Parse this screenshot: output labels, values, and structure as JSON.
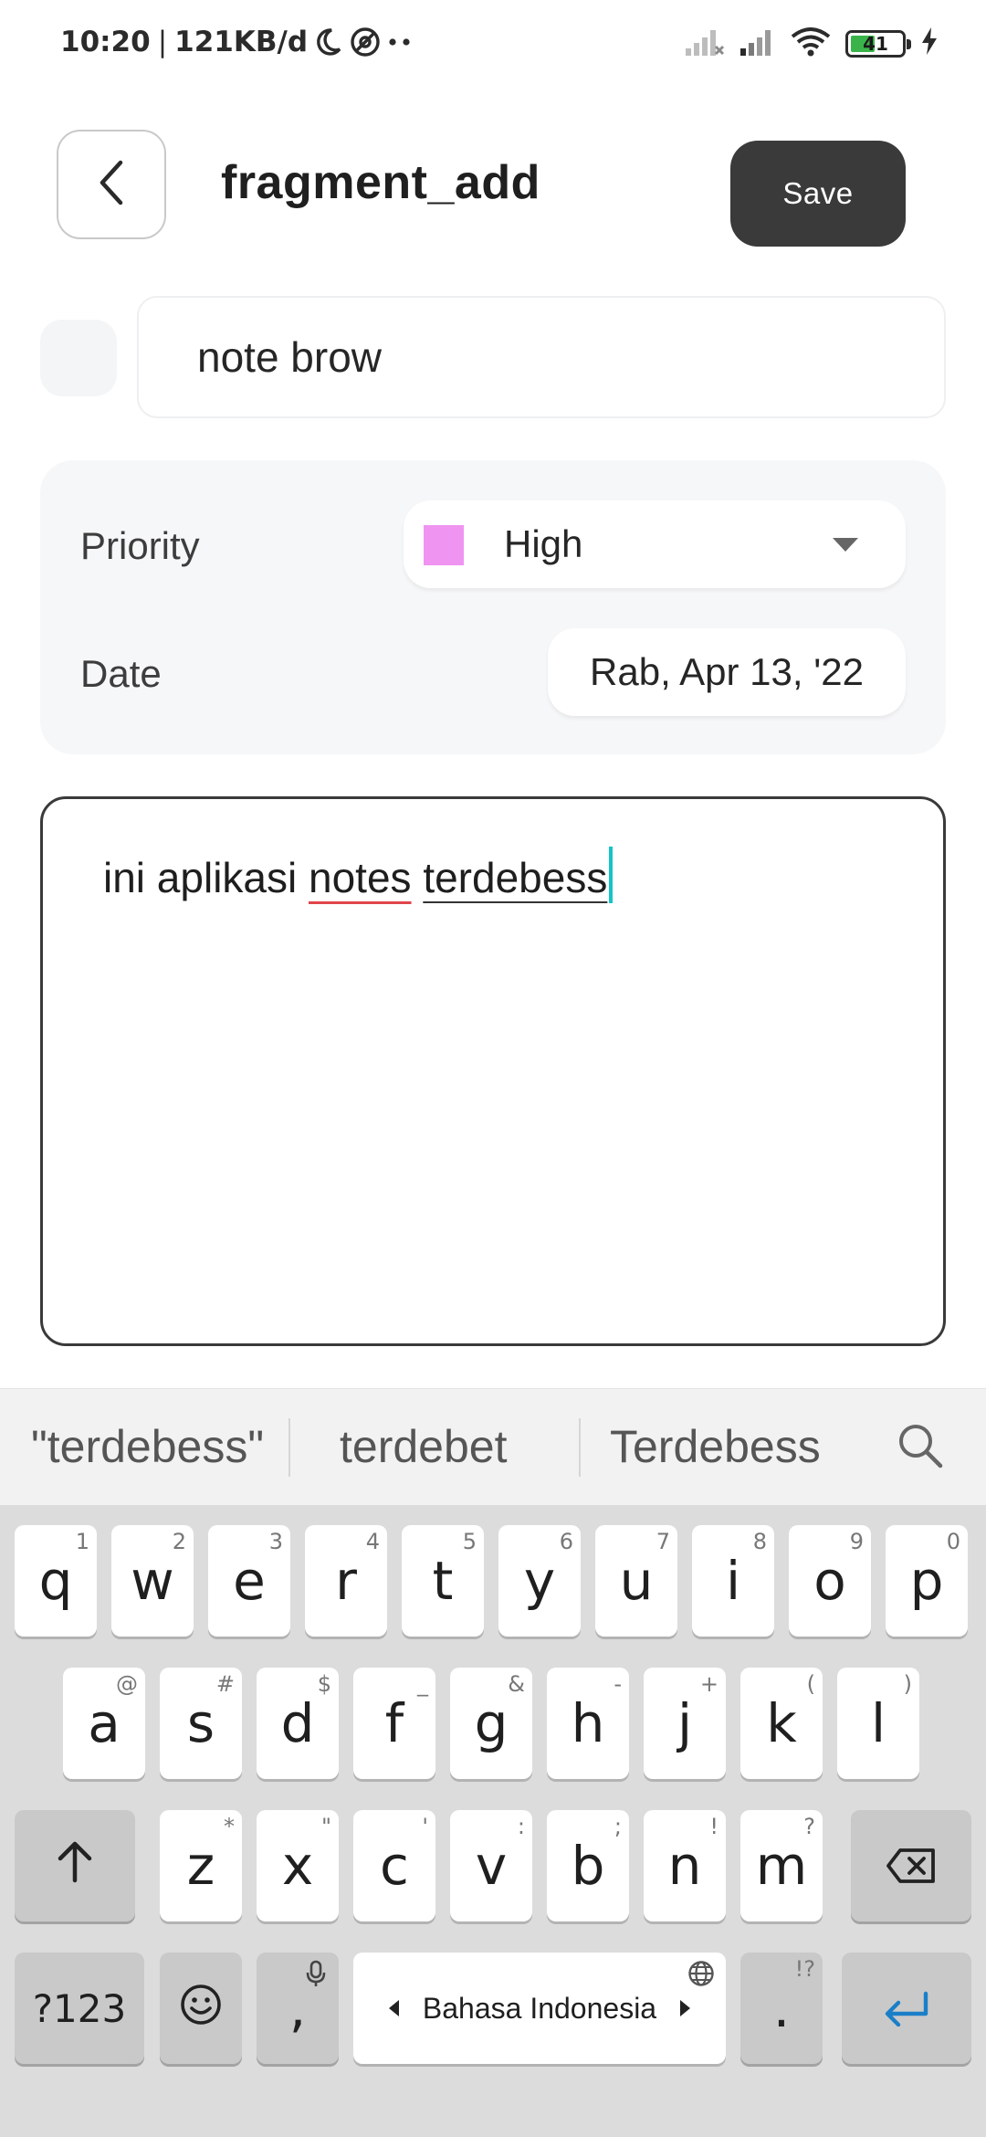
{
  "status_bar": {
    "time": "10:20",
    "separator": "|",
    "network_speed": "121KB/d",
    "battery_level": "41",
    "icons": [
      "moon-icon",
      "vpn-icon",
      "more-dots-icon",
      "signal-x-icon",
      "signal-icon",
      "wifi-icon",
      "battery-icon",
      "charging-icon"
    ]
  },
  "header": {
    "title": "fragment_add",
    "save_label": "Save",
    "back_icon": "chevron-left-icon"
  },
  "note": {
    "title": "note brow",
    "body_plain": "ini aplikasi ",
    "body_misspelled": "notes",
    "body_space": " ",
    "body_composing": "terdebess"
  },
  "settings": {
    "priority_label": "Priority",
    "priority_value": "High",
    "priority_color": "#ef94f1",
    "date_label": "Date",
    "date_value": "Rab, Apr 13, '22"
  },
  "keyboard": {
    "suggestions": [
      "\"terdebess\"",
      "terdebet",
      "Terdebess"
    ],
    "row1": [
      {
        "key": "q",
        "hint": "1"
      },
      {
        "key": "w",
        "hint": "2"
      },
      {
        "key": "e",
        "hint": "3"
      },
      {
        "key": "r",
        "hint": "4"
      },
      {
        "key": "t",
        "hint": "5"
      },
      {
        "key": "y",
        "hint": "6"
      },
      {
        "key": "u",
        "hint": "7"
      },
      {
        "key": "i",
        "hint": "8"
      },
      {
        "key": "o",
        "hint": "9"
      },
      {
        "key": "p",
        "hint": "0"
      }
    ],
    "row2": [
      {
        "key": "a",
        "hint": "@"
      },
      {
        "key": "s",
        "hint": "#"
      },
      {
        "key": "d",
        "hint": "$"
      },
      {
        "key": "f",
        "hint": "_"
      },
      {
        "key": "g",
        "hint": "&"
      },
      {
        "key": "h",
        "hint": "-"
      },
      {
        "key": "j",
        "hint": "+"
      },
      {
        "key": "k",
        "hint": "("
      },
      {
        "key": "l",
        "hint": ")"
      }
    ],
    "row3": [
      {
        "key": "z",
        "hint": "*"
      },
      {
        "key": "x",
        "hint": "\""
      },
      {
        "key": "c",
        "hint": "'"
      },
      {
        "key": "v",
        "hint": ":"
      },
      {
        "key": "b",
        "hint": ";"
      },
      {
        "key": "n",
        "hint": "!"
      },
      {
        "key": "m",
        "hint": "?"
      }
    ],
    "symbols_label": "?123",
    "comma": ",",
    "space_label": "Bahasa Indonesia",
    "period": ".",
    "period_hint": "!?"
  }
}
